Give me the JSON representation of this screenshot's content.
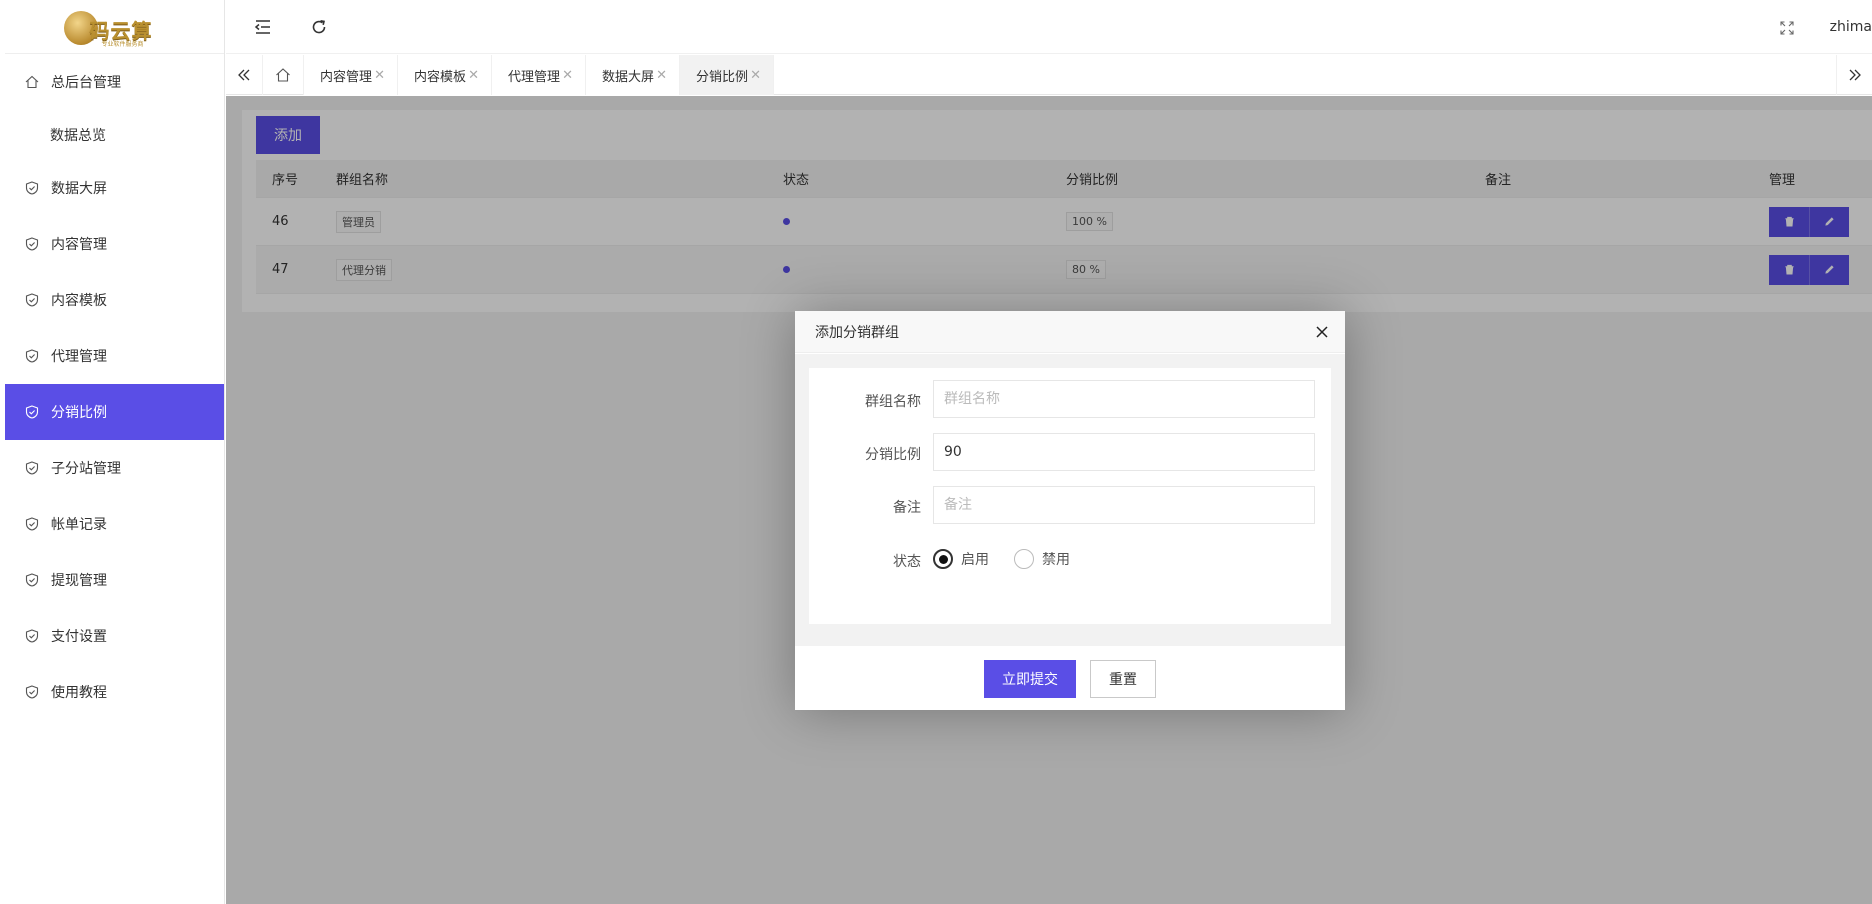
{
  "logo": {
    "title": "码云算",
    "subtitle": "专业软件服务商"
  },
  "header": {
    "username": "zhima"
  },
  "sidebar": {
    "items": [
      {
        "label": "总后台管理"
      },
      {
        "label": "数据总览"
      },
      {
        "label": "数据大屏"
      },
      {
        "label": "内容管理"
      },
      {
        "label": "内容模板"
      },
      {
        "label": "代理管理"
      },
      {
        "label": "分销比例"
      },
      {
        "label": "子分站管理"
      },
      {
        "label": "帐单记录"
      },
      {
        "label": "提现管理"
      },
      {
        "label": "支付设置"
      },
      {
        "label": "使用教程"
      }
    ]
  },
  "tabs": [
    {
      "label": "内容管理"
    },
    {
      "label": "内容模板"
    },
    {
      "label": "代理管理"
    },
    {
      "label": "数据大屏"
    },
    {
      "label": "分销比例"
    }
  ],
  "toolbar": {
    "add_label": "添加"
  },
  "table": {
    "headers": [
      "序号",
      "群组名称",
      "状态",
      "分销比例",
      "备注",
      "管理"
    ],
    "rows": [
      {
        "id": "46",
        "name": "管理员",
        "ratio": "100 %"
      },
      {
        "id": "47",
        "name": "代理分销",
        "ratio": "80 %"
      }
    ]
  },
  "modal": {
    "title": "添加分销群组",
    "fields": {
      "name": {
        "label": "群组名称",
        "placeholder": "群组名称",
        "value": ""
      },
      "ratio": {
        "label": "分销比例",
        "value": "90"
      },
      "remark": {
        "label": "备注",
        "placeholder": "备注",
        "value": ""
      },
      "status": {
        "label": "状态",
        "options": [
          "启用",
          "禁用"
        ],
        "selected": "启用"
      }
    },
    "submit_label": "立即提交",
    "reset_label": "重置"
  },
  "colors": {
    "accent": "#5a4ee6"
  }
}
